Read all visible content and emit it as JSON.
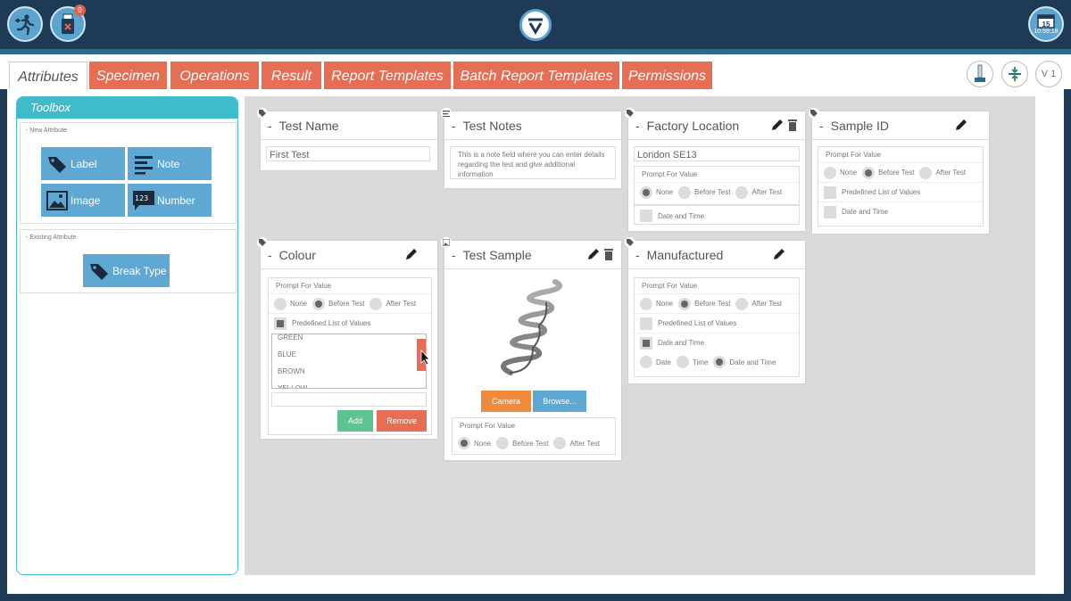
{
  "topbar": {
    "notifications_count": "0",
    "clock_day": "15",
    "clock_time": "10:59:18"
  },
  "tabs": [
    {
      "label": "Attributes"
    },
    {
      "label": "Specimen"
    },
    {
      "label": "Operations"
    },
    {
      "label": "Result"
    },
    {
      "label": "Report Templates"
    },
    {
      "label": "Batch Report Templates"
    },
    {
      "label": "Permissions"
    }
  ],
  "version_label": "V 1",
  "toolbox": {
    "title": "Toolbox",
    "new_section": "New Attribute",
    "new_items": [
      {
        "label": "Label",
        "icon": "tag-icon"
      },
      {
        "label": "Note",
        "icon": "lines-icon"
      },
      {
        "label": "Image",
        "icon": "image-icon"
      },
      {
        "label": "Number",
        "icon": "number-icon"
      }
    ],
    "existing_section": "Existing Attribute",
    "existing_items": [
      {
        "label": "Break Type",
        "icon": "tag-icon"
      }
    ]
  },
  "cards": {
    "test_name": {
      "title": "Test Name",
      "value": "First Test"
    },
    "test_notes": {
      "title": "Test Notes",
      "value": "This is a note field where you can enter details regarding the test and give additional information"
    },
    "factory_location": {
      "title": "Factory Location",
      "value": "London SE13",
      "prompt_label": "Prompt For Value",
      "options": [
        "None",
        "Before Test",
        "After Test"
      ],
      "selected": "None",
      "datetime_label": "Date and Time"
    },
    "sample_id": {
      "title": "Sample ID",
      "prompt_label": "Prompt For Value",
      "options": [
        "None",
        "Before Test",
        "After Test"
      ],
      "selected": "Before Test",
      "predefined_label": "Predefined List of Values",
      "datetime_label": "Date and Time"
    },
    "colour": {
      "title": "Colour",
      "prompt_label": "Prompt For Value",
      "options": [
        "None",
        "Before Test",
        "After Test"
      ],
      "selected": "Before Test",
      "predefined_label": "Predefined List of Values",
      "values": [
        "GREEN",
        "BLUE",
        "BROWN",
        "YELLOW"
      ],
      "add_label": "Add",
      "remove_label": "Remove"
    },
    "test_sample": {
      "title": "Test Sample",
      "camera_label": "Camera",
      "browse_label": "Browse...",
      "prompt_label": "Prompt For Value",
      "options": [
        "None",
        "Before Test",
        "After Test"
      ],
      "selected": "None"
    },
    "manufactured": {
      "title": "Manufactured",
      "prompt_label": "Prompt For Value",
      "options": [
        "None",
        "Before Test",
        "After Test"
      ],
      "selected": "Before Test",
      "predefined_label": "Predefined List of Values",
      "datetime_label": "Date and Time",
      "dt_options": [
        "Date",
        "Time",
        "Date and Time"
      ],
      "dt_selected": "Date and Time"
    }
  },
  "colors": {
    "accent": "#e56e55",
    "teal": "#3fbcc9",
    "blue": "#5fa8d3",
    "green": "#5fc38f",
    "dark": "#1e3a55"
  }
}
